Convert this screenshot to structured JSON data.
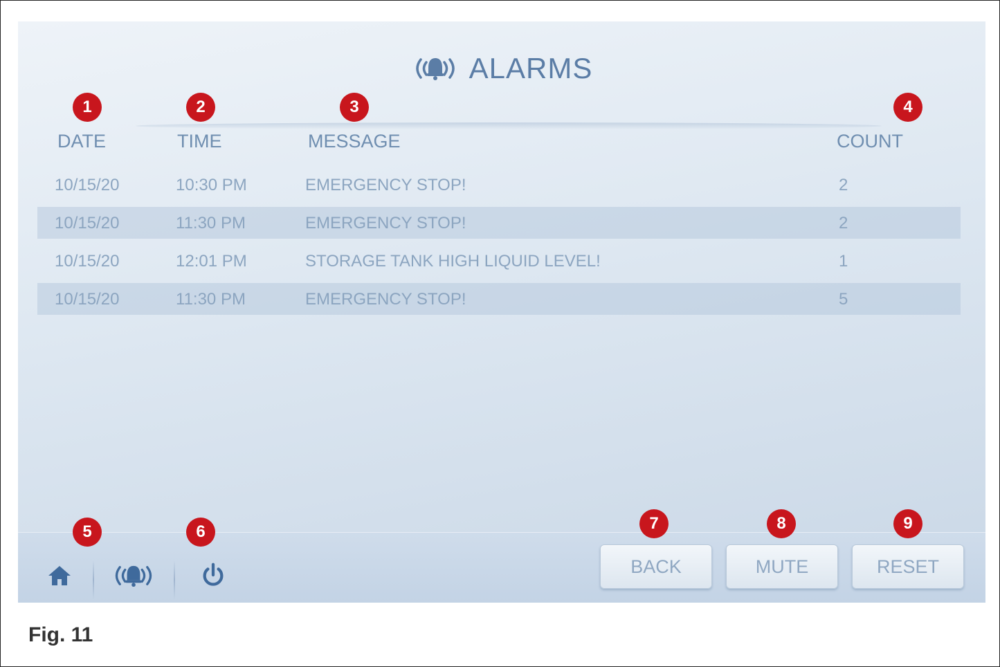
{
  "screen": {
    "title": "ALARMS",
    "title_icon": "alarm-bell-icon"
  },
  "columns": {
    "date": "DATE",
    "time": "TIME",
    "message": "MESSAGE",
    "count": "COUNT"
  },
  "rows": [
    {
      "date": "10/15/20",
      "time": "10:30 PM",
      "message": "EMERGENCY STOP!",
      "count": "2"
    },
    {
      "date": "10/15/20",
      "time": "11:30 PM",
      "message": "EMERGENCY STOP!",
      "count": "2"
    },
    {
      "date": "10/15/20",
      "time": "12:01 PM",
      "message": "STORAGE TANK HIGH LIQUID LEVEL!",
      "count": "1"
    },
    {
      "date": "10/15/20",
      "time": "11:30 PM",
      "message": "EMERGENCY STOP!",
      "count": "5"
    }
  ],
  "nav": {
    "icons": [
      "home-icon",
      "alarm-bell-icon",
      "power-icon"
    ]
  },
  "buttons": {
    "back": "BACK",
    "mute": "MUTE",
    "reset": "RESET"
  },
  "callouts": [
    "1",
    "2",
    "3",
    "4",
    "5",
    "6",
    "7",
    "8",
    "9"
  ],
  "figure": {
    "caption": "Fig. 11"
  },
  "colors": {
    "accent": "#5b7da6",
    "badge": "#c8161d",
    "text_muted": "#8ca5c0"
  }
}
